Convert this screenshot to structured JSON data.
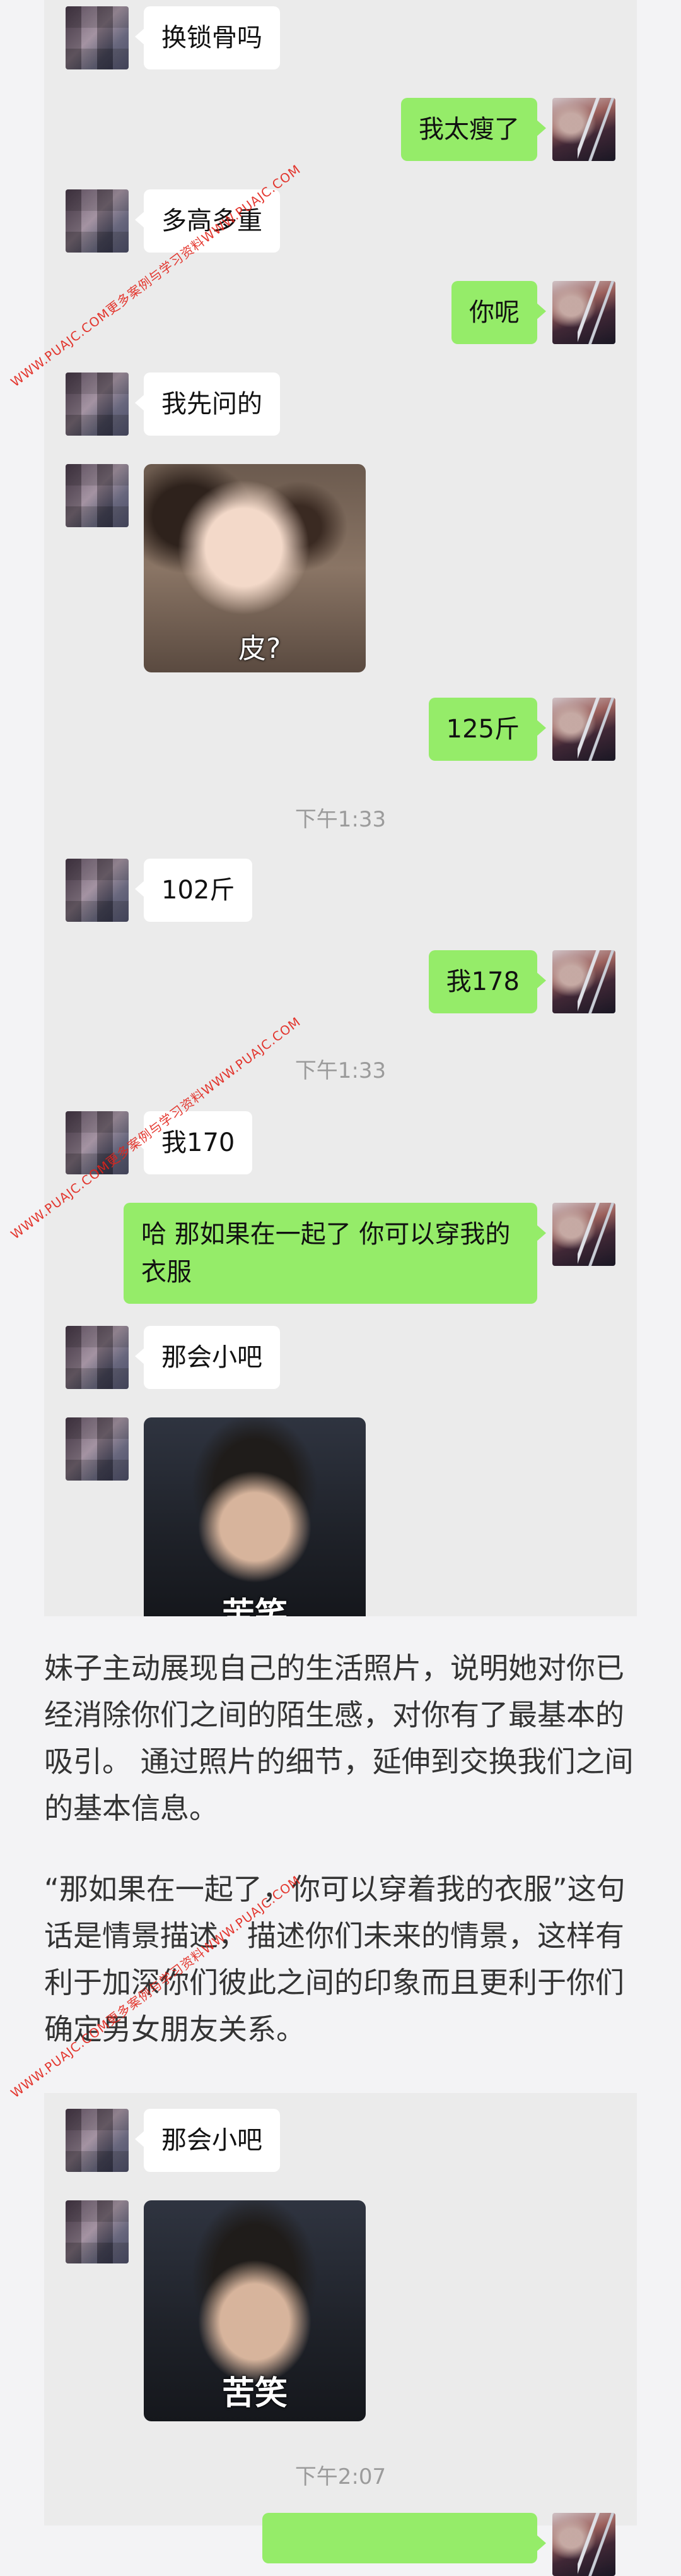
{
  "chat1": {
    "messages": [
      {
        "side": "left",
        "text": "换锁骨吗"
      },
      {
        "side": "right",
        "text": "我太瘦了"
      },
      {
        "side": "left",
        "text": "多高多重"
      },
      {
        "side": "right",
        "text": "你呢"
      },
      {
        "side": "left",
        "text": "我先问的"
      },
      {
        "side": "left",
        "image": "girl-sticker",
        "caption": "皮?"
      },
      {
        "side": "right",
        "text": "125斤"
      },
      {
        "timestamp": "下午1:33"
      },
      {
        "side": "left",
        "text": "102斤"
      },
      {
        "side": "right",
        "text": "我178"
      },
      {
        "timestamp": "下午1:33"
      },
      {
        "side": "left",
        "text": "我170"
      },
      {
        "side": "right",
        "text": "哈 那如果在一起了 你可以穿我的衣服"
      },
      {
        "side": "left",
        "text": "那会小吧"
      },
      {
        "side": "left",
        "image": "boy-sticker",
        "caption": "苦笑"
      }
    ]
  },
  "article": {
    "paragraph1": "妹子主动展现自己的生活照片，说明她对你已经消除你们之间的陌生感，对你有了最基本的吸引。 通过照片的细节，延伸到交换我们之间的基本信息。",
    "paragraph2": "“那如果在一起了，你可以穿着我的衣服”这句话是情景描述，描述你们未来的情景，这样有利于加深你们彼此之间的印象而且更利于你们确定男女朋友关系。"
  },
  "chat2": {
    "messages": [
      {
        "side": "left",
        "text": "那会小吧"
      },
      {
        "side": "left",
        "image": "boy-sticker",
        "caption": "苦笑"
      },
      {
        "timestamp": "下午2:07"
      }
    ]
  },
  "watermark": {
    "text": "WWW.PUAJC.COM更多案例与学习资料WWW.PUAJC.COM"
  },
  "colors": {
    "chat_bg": "#ebebeb",
    "page_bg": "#f3f3f5",
    "my_bubble": "#95ec69",
    "their_bubble": "#ffffff",
    "watermark": "#e2231a"
  }
}
